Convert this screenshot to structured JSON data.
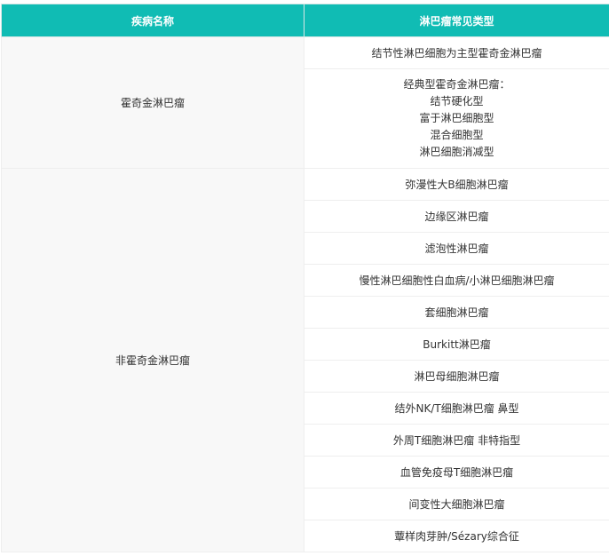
{
  "table": {
    "headers": [
      "疾病名称",
      "淋巴瘤常见类型"
    ],
    "groups": [
      {
        "disease": "霍奇金淋巴瘤",
        "types": [
          {
            "lines": [
              "结节性淋巴细胞为主型霍奇金淋巴瘤"
            ]
          },
          {
            "lines": [
              "经典型霍奇金淋巴瘤：",
              "结节硬化型",
              "富于淋巴细胞型",
              "混合细胞型",
              "淋巴细胞消减型"
            ]
          }
        ]
      },
      {
        "disease": "非霍奇金淋巴瘤",
        "types": [
          {
            "lines": [
              "弥漫性大B细胞淋巴瘤"
            ]
          },
          {
            "lines": [
              "边缘区淋巴瘤"
            ]
          },
          {
            "lines": [
              "滤泡性淋巴瘤"
            ]
          },
          {
            "lines": [
              "慢性淋巴细胞性白血病/小淋巴细胞淋巴瘤"
            ]
          },
          {
            "lines": [
              "套细胞淋巴瘤"
            ]
          },
          {
            "lines": [
              "Burkitt淋巴瘤"
            ]
          },
          {
            "lines": [
              "淋巴母细胞淋巴瘤"
            ]
          },
          {
            "lines": [
              "结外NK/T细胞淋巴瘤 鼻型"
            ]
          },
          {
            "lines": [
              "外周T细胞淋巴瘤 非特指型"
            ]
          },
          {
            "lines": [
              "血管免疫母T细胞淋巴瘤"
            ]
          },
          {
            "lines": [
              "间变性大细胞淋巴瘤"
            ]
          },
          {
            "lines": [
              "蕈样肉芽肿/Sézary综合征"
            ]
          }
        ]
      }
    ]
  }
}
